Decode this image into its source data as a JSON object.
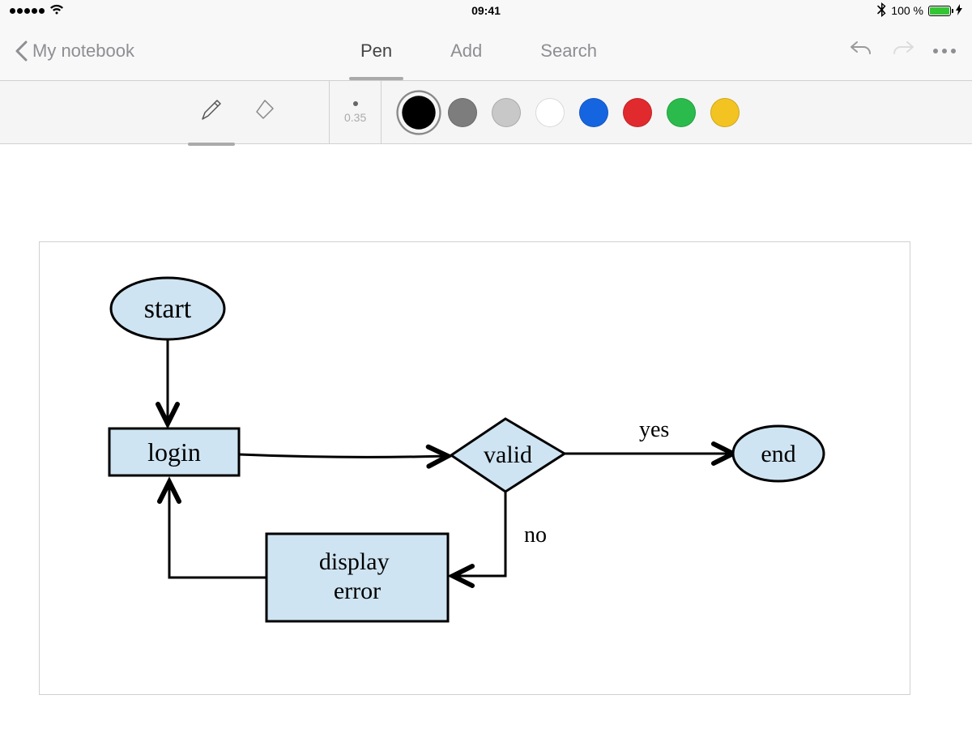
{
  "status_bar": {
    "time": "09:41",
    "battery_label": "100 %"
  },
  "header": {
    "back_label": "My notebook",
    "tabs": [
      {
        "label": "Pen",
        "active": true
      },
      {
        "label": "Add",
        "active": false
      },
      {
        "label": "Search",
        "active": false
      }
    ]
  },
  "toolbar": {
    "pen_size_label": "0.35",
    "colors": [
      {
        "name": "black",
        "hex": "#000000",
        "selected": true
      },
      {
        "name": "gray",
        "hex": "#7d7d7d",
        "selected": false
      },
      {
        "name": "silver",
        "hex": "#c8c8c8",
        "selected": false
      },
      {
        "name": "white",
        "hex": "#ffffff",
        "selected": false
      },
      {
        "name": "blue",
        "hex": "#1665e0",
        "selected": false
      },
      {
        "name": "red",
        "hex": "#e12a2e",
        "selected": false
      },
      {
        "name": "green",
        "hex": "#2bbb4c",
        "selected": false
      },
      {
        "name": "yellow",
        "hex": "#f3c421",
        "selected": false
      }
    ]
  },
  "diagram": {
    "nodes": {
      "start": {
        "label": "start"
      },
      "login": {
        "label": "login"
      },
      "valid": {
        "label": "valid"
      },
      "display_error": {
        "label": "display\nerror"
      },
      "end": {
        "label": "end"
      }
    },
    "edges": {
      "yes": {
        "label": "yes"
      },
      "no": {
        "label": "no"
      }
    }
  }
}
